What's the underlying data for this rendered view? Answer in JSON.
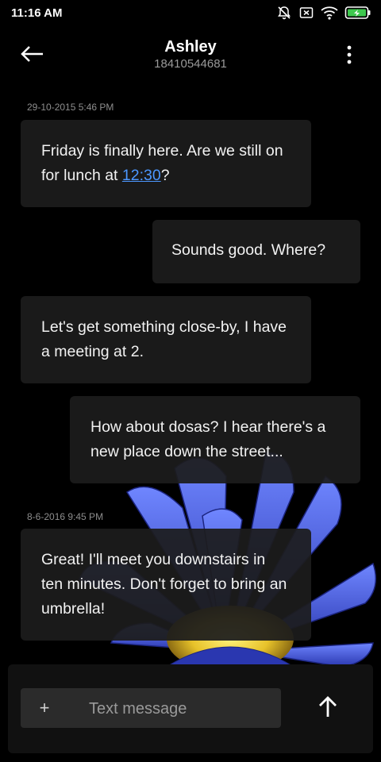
{
  "status_bar": {
    "time": "11:16 AM",
    "icons": [
      "bell-off-icon",
      "sim-card-icon",
      "wifi-icon",
      "battery-charging-icon"
    ]
  },
  "header": {
    "contact_name": "Ashley",
    "phone_number": "18410544681",
    "back_icon": "arrow-left-icon",
    "menu_icon": "more-vertical-icon"
  },
  "messages": [
    {
      "timestamp": "29-10-2015 5:46 PM"
    },
    {
      "direction": "incoming",
      "text_before": "Friday is finally here. Are we still on for lunch at ",
      "link": "12:30",
      "text_after": "?"
    },
    {
      "direction": "outgoing",
      "text": "Sounds good. Where?"
    },
    {
      "direction": "incoming",
      "text": "Let's get something close-by, I have a meeting at 2."
    },
    {
      "direction": "outgoing",
      "text": "How about dosas? I hear there's a new place down the street..."
    },
    {
      "timestamp": "8-6-2016 9:45 PM"
    },
    {
      "direction": "incoming",
      "text": "Great! I'll meet you downstairs in ten minutes. Don't forget to bring an umbrella!"
    }
  ],
  "composer": {
    "add_label": "+",
    "placeholder": "Text message",
    "value": "",
    "send_icon": "arrow-up-icon"
  },
  "colors": {
    "background": "#000000",
    "bubble": "#1c1c1c",
    "link": "#4c97ff",
    "flower_petal": "#3f5fe0",
    "flower_center": "#f0d23a"
  }
}
